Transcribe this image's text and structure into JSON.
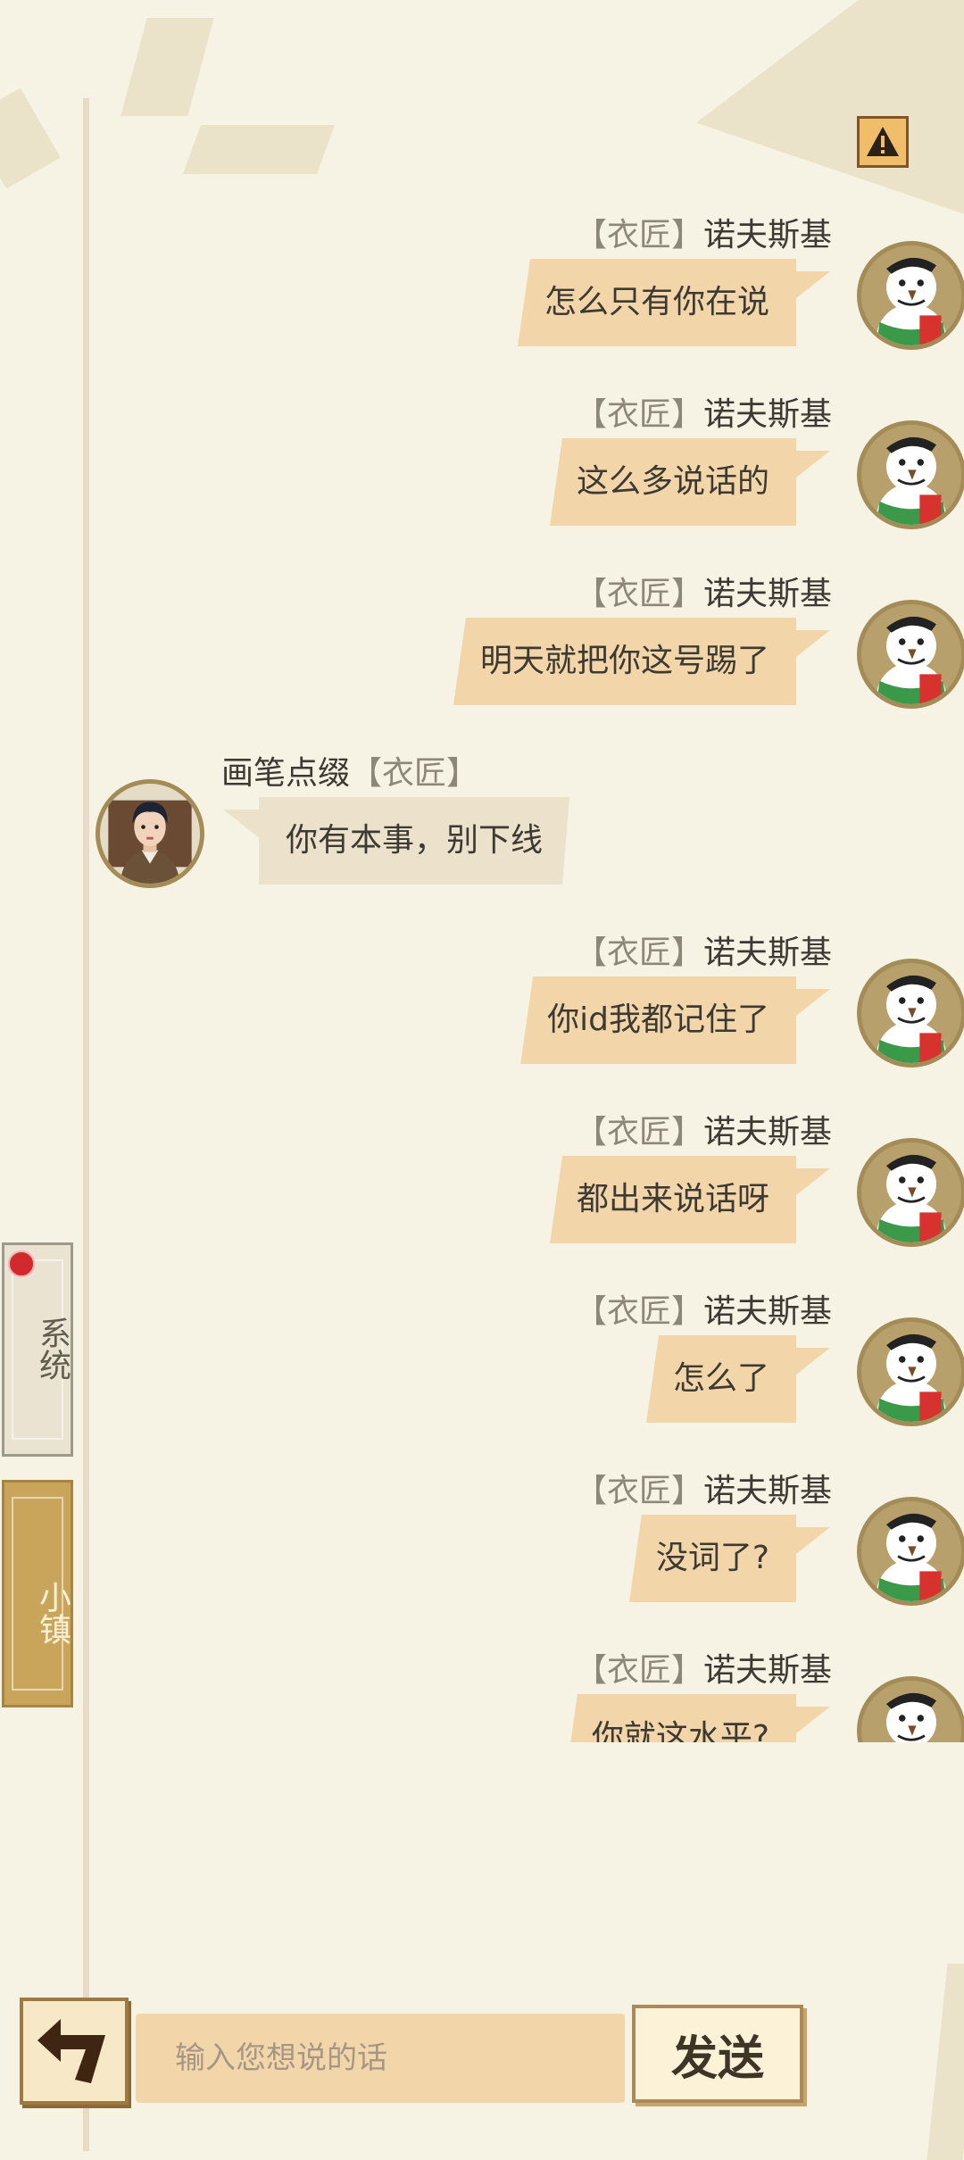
{
  "warning_icon": "warning-icon",
  "side_tabs": [
    {
      "label": "系统",
      "active": false
    },
    {
      "label": "小镇",
      "active": true
    }
  ],
  "messages": [
    {
      "side": "right",
      "tag": "【衣匠】",
      "name": "诺夫斯基",
      "text": "怎么只有你在说",
      "avatar": "snowman-avatar"
    },
    {
      "side": "right",
      "tag": "【衣匠】",
      "name": "诺夫斯基",
      "text": "这么多说话的",
      "avatar": "snowman-avatar"
    },
    {
      "side": "right",
      "tag": "【衣匠】",
      "name": "诺夫斯基",
      "text": "明天就把你这号踢了",
      "avatar": "snowman-avatar"
    },
    {
      "side": "left",
      "tag": "【衣匠】",
      "name": "画笔点缀",
      "text": "你有本事，别下线",
      "avatar": "person-avatar"
    },
    {
      "side": "right",
      "tag": "【衣匠】",
      "name": "诺夫斯基",
      "text": "你id我都记住了",
      "avatar": "snowman-avatar"
    },
    {
      "side": "right",
      "tag": "【衣匠】",
      "name": "诺夫斯基",
      "text": "都出来说话呀",
      "avatar": "snowman-avatar"
    },
    {
      "side": "right",
      "tag": "【衣匠】",
      "name": "诺夫斯基",
      "text": "怎么了",
      "avatar": "snowman-avatar"
    },
    {
      "side": "right",
      "tag": "【衣匠】",
      "name": "诺夫斯基",
      "text": "没词了?",
      "avatar": "snowman-avatar"
    },
    {
      "side": "right",
      "tag": "【衣匠】",
      "name": "诺夫斯基",
      "text": "你就这水平?",
      "avatar": "snowman-avatar"
    }
  ],
  "input": {
    "placeholder": "输入您想说的话",
    "value": ""
  },
  "send_label": "发送",
  "back_icon": "back-arrow-icon",
  "colors": {
    "bubble_self": "#f3d5aa",
    "bubble_other": "#ece2cb",
    "background": "#f7f3e4",
    "tag": "#8d8779"
  }
}
